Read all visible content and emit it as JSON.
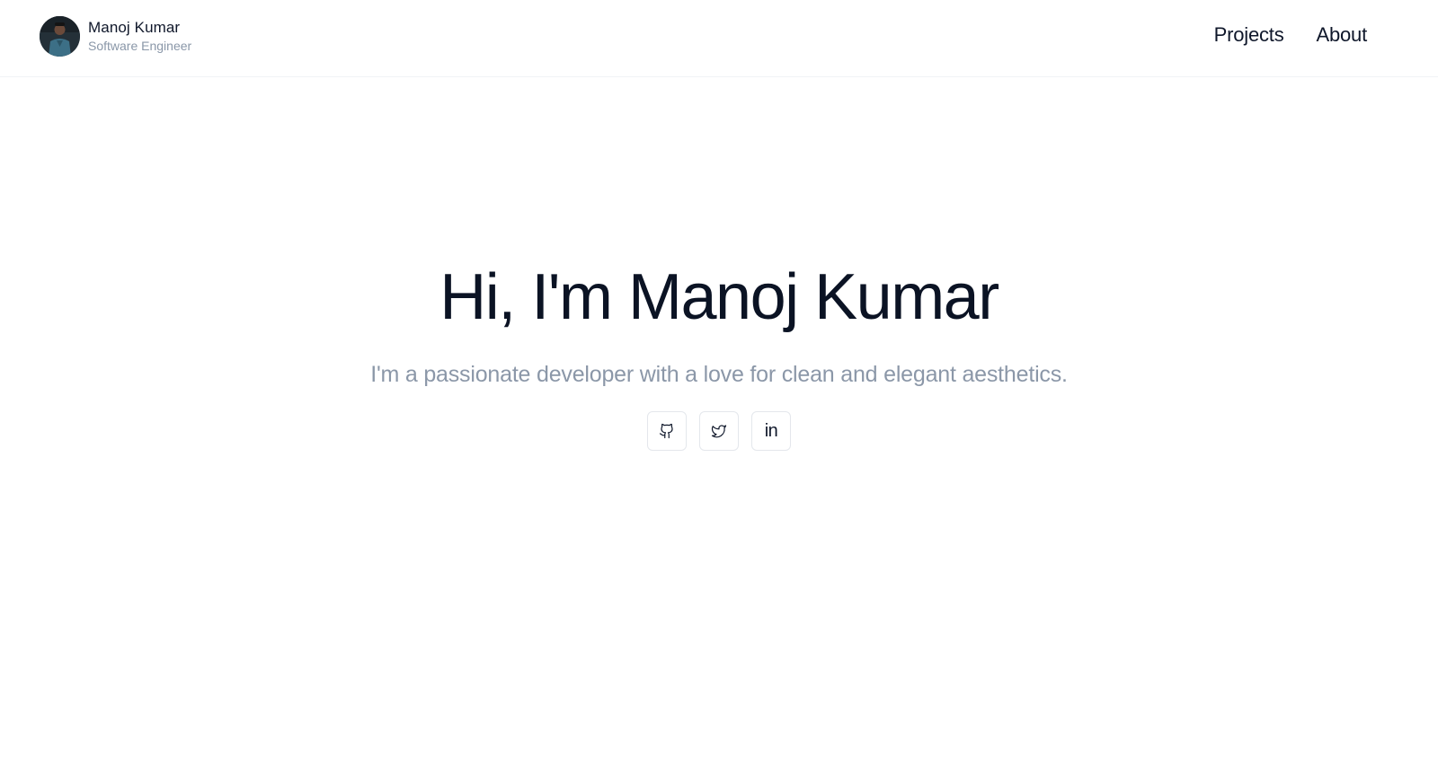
{
  "header": {
    "name": "Manoj Kumar",
    "role": "Software Engineer",
    "avatar_icon": "profile-photo",
    "nav": [
      {
        "label": "Projects"
      },
      {
        "label": "About"
      }
    ]
  },
  "hero": {
    "title": "Hi, I'm Manoj Kumar",
    "subtitle": "I'm a passionate developer with a love for clean and elegant aesthetics."
  },
  "socials": [
    {
      "icon": "github-icon"
    },
    {
      "icon": "twitter-icon"
    },
    {
      "icon": "linkedin-icon",
      "glyph": "in"
    }
  ],
  "colors": {
    "text": "#0f172a",
    "muted": "#8b97a8",
    "border": "#e4e7ec"
  }
}
